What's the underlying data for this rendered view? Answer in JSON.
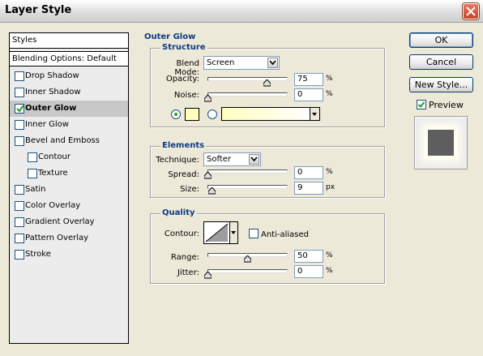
{
  "window": {
    "title": "Layer Style"
  },
  "styles": {
    "header": "Styles",
    "blending_options": "Blending Options: Default",
    "items": [
      {
        "label": "Drop Shadow",
        "checked": false
      },
      {
        "label": "Inner Shadow",
        "checked": false
      },
      {
        "label": "Outer Glow",
        "checked": true,
        "selected": true
      },
      {
        "label": "Inner Glow",
        "checked": false
      },
      {
        "label": "Bevel and Emboss",
        "checked": false
      },
      {
        "label": "Contour",
        "checked": false,
        "indent": true
      },
      {
        "label": "Texture",
        "checked": false,
        "indent": true
      },
      {
        "label": "Satin",
        "checked": false
      },
      {
        "label": "Color Overlay",
        "checked": false
      },
      {
        "label": "Gradient Overlay",
        "checked": false
      },
      {
        "label": "Pattern Overlay",
        "checked": false
      },
      {
        "label": "Stroke",
        "checked": false
      }
    ]
  },
  "outer_glow": {
    "title": "Outer Glow",
    "structure": {
      "title": "Structure",
      "blend_mode_label": "Blend Mode:",
      "blend_mode_value": "Screen",
      "opacity_label": "Opacity:",
      "opacity_value": "75",
      "opacity_unit": "%",
      "opacity_level": 0.75,
      "noise_label": "Noise:",
      "noise_value": "0",
      "noise_unit": "%",
      "noise_level": 0,
      "color": "#ffffbe",
      "color_mode": "solid"
    },
    "elements": {
      "title": "Elements",
      "technique_label": "Technique:",
      "technique_value": "Softer",
      "spread_label": "Spread:",
      "spread_value": "0",
      "spread_unit": "%",
      "spread_level": 0,
      "size_label": "Size:",
      "size_value": "9",
      "size_unit": "px",
      "size_level": 0.05
    },
    "quality": {
      "title": "Quality",
      "contour_label": "Contour:",
      "anti_aliased_label": "Anti-aliased",
      "anti_aliased_checked": false,
      "range_label": "Range:",
      "range_value": "50",
      "range_unit": "%",
      "range_level": 0.5,
      "jitter_label": "Jitter:",
      "jitter_value": "0",
      "jitter_unit": "%",
      "jitter_level": 0
    }
  },
  "actions": {
    "ok": "OK",
    "cancel": "Cancel",
    "new_style": "New Style...",
    "preview_label": "Preview",
    "preview_checked": true
  },
  "colors": {
    "accent": "#0c3a86",
    "check": "#21a121",
    "preview_square": "#5e5e5e"
  }
}
